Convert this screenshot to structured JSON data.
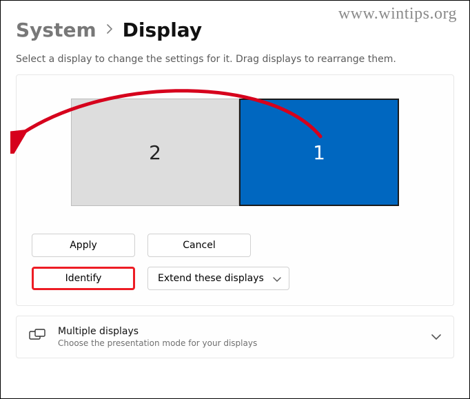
{
  "watermark": "www.wintips.org",
  "breadcrumb": {
    "parent": "System",
    "current": "Display"
  },
  "instruction": "Select a display to change the settings for it. Drag displays to rearrange them.",
  "monitors": {
    "secondary_number": "2",
    "primary_number": "1"
  },
  "buttons": {
    "apply": "Apply",
    "cancel": "Cancel",
    "identify": "Identify"
  },
  "display_mode": {
    "selected": "Extend these displays"
  },
  "multiple_displays": {
    "title": "Multiple displays",
    "subtitle": "Choose the presentation mode for your displays"
  },
  "colors": {
    "primary_monitor_bg": "#0067c0",
    "highlight_red": "#ed1c24",
    "arrow_red": "#d6001c"
  }
}
